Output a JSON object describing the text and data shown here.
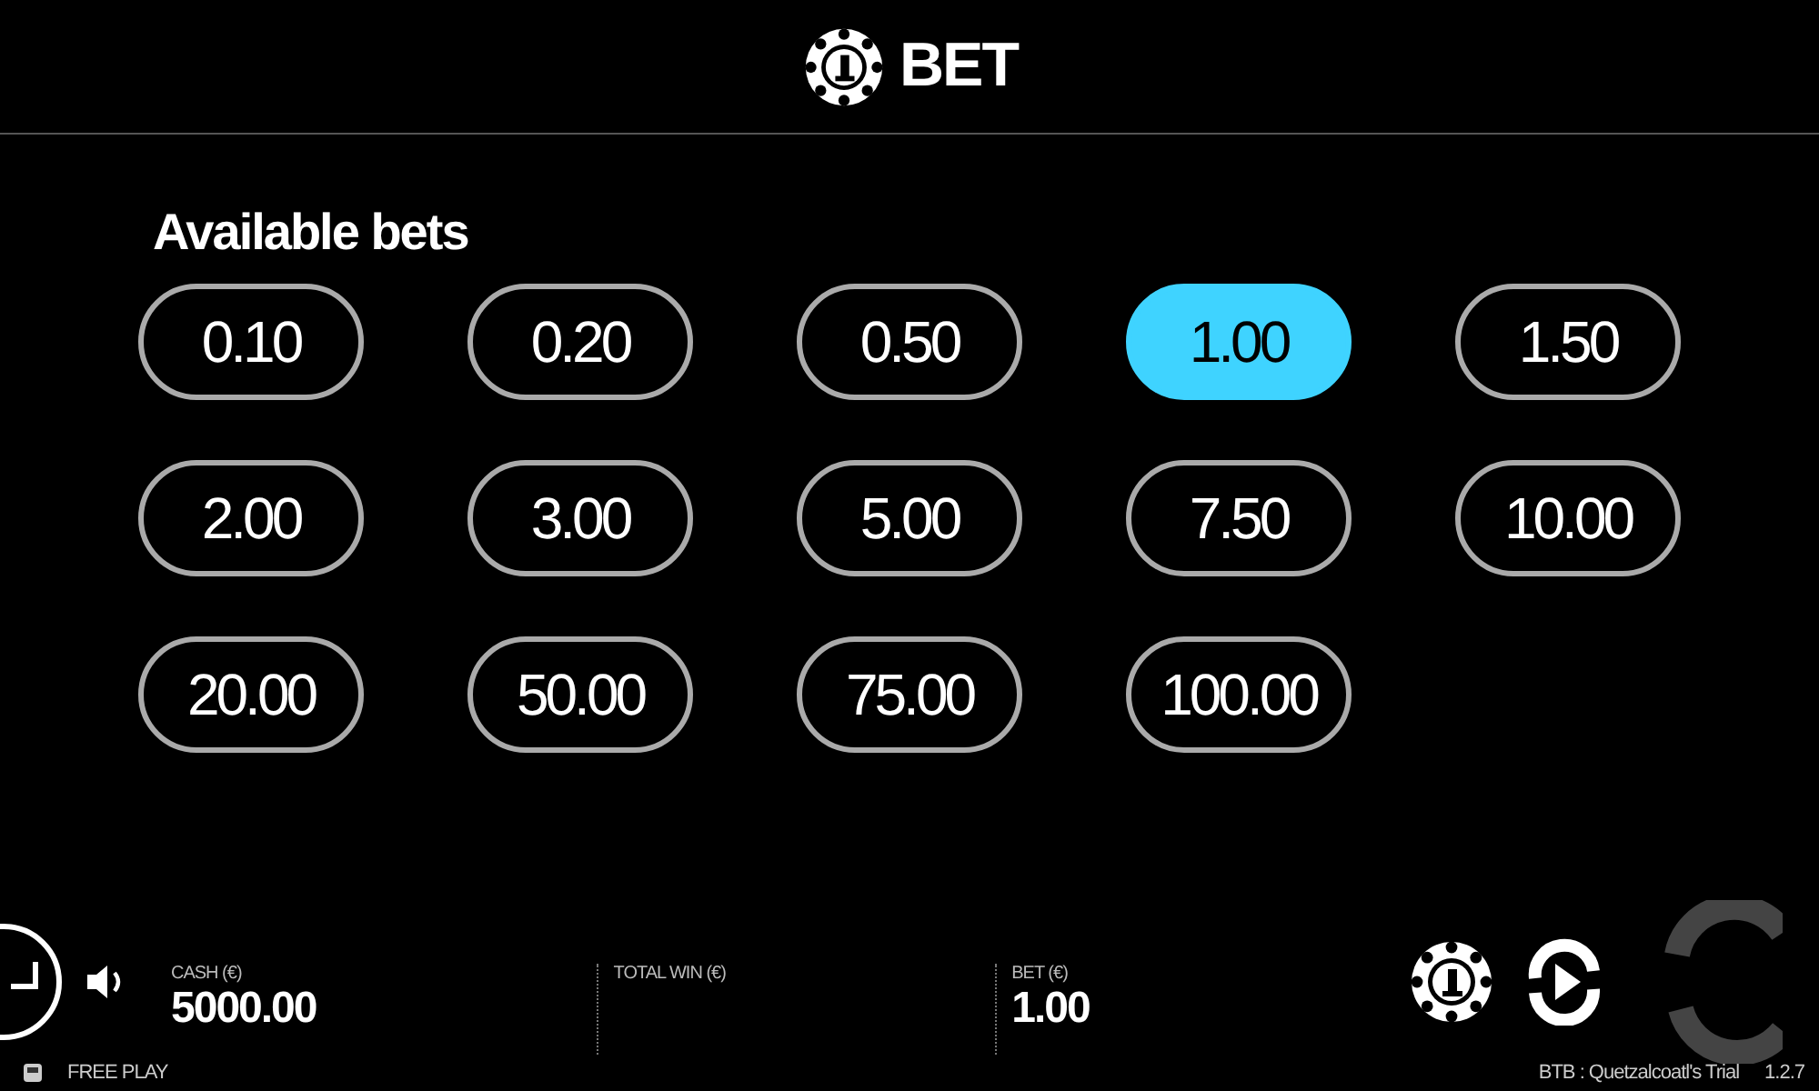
{
  "header": {
    "title": "BET"
  },
  "bets": {
    "title": "Available bets",
    "options": [
      {
        "label": "0.10",
        "selected": false
      },
      {
        "label": "0.20",
        "selected": false
      },
      {
        "label": "0.50",
        "selected": false
      },
      {
        "label": "1.00",
        "selected": true
      },
      {
        "label": "1.50",
        "selected": false
      },
      {
        "label": "2.00",
        "selected": false
      },
      {
        "label": "3.00",
        "selected": false
      },
      {
        "label": "5.00",
        "selected": false
      },
      {
        "label": "7.50",
        "selected": false
      },
      {
        "label": "10.00",
        "selected": false
      },
      {
        "label": "20.00",
        "selected": false
      },
      {
        "label": "50.00",
        "selected": false
      },
      {
        "label": "75.00",
        "selected": false
      },
      {
        "label": "100.00",
        "selected": false
      }
    ]
  },
  "status": [
    {
      "label": "CASH (€)",
      "value": "5000.00"
    },
    {
      "label": "TOTAL WIN (€)"
    },
    {
      "label": "BET (€)",
      "value": "1.00"
    }
  ],
  "footer": {
    "mode": "FREE PLAY",
    "game": "BTB : Quetzalcoatl's Trial",
    "version": "1.2.7"
  }
}
